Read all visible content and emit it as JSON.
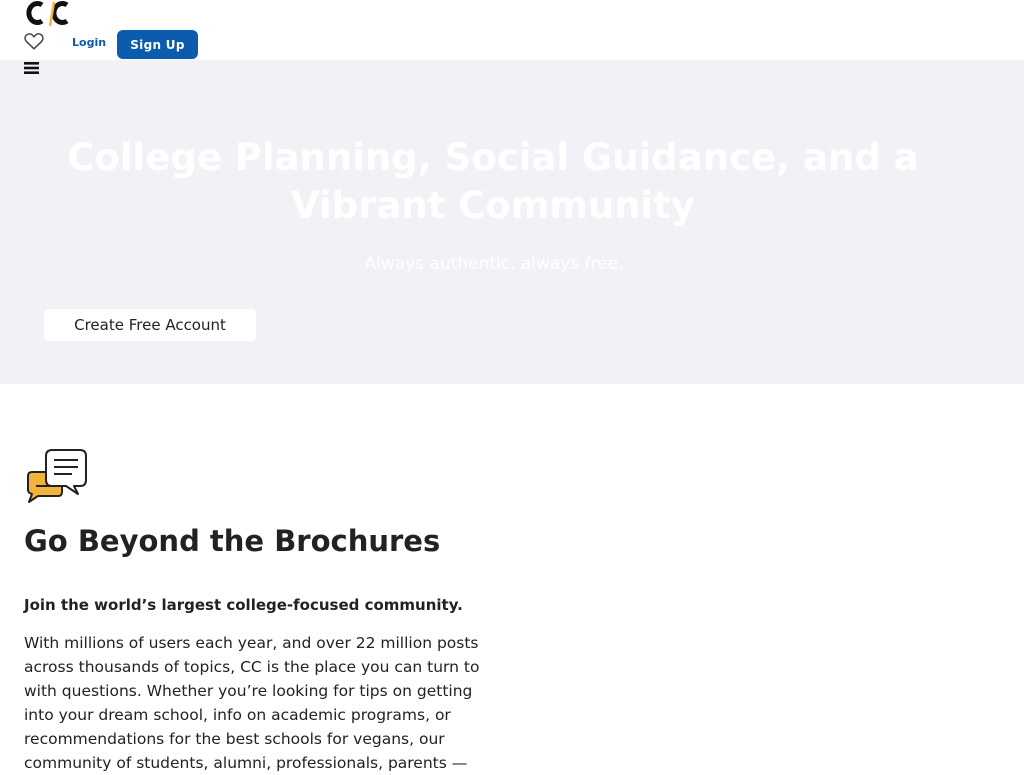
{
  "header": {
    "logo_icon": "cc-logo-icon",
    "favorites_icon": "heart-icon",
    "login_label": "Login",
    "signup_label": "Sign Up"
  },
  "hero": {
    "menu_icon": "hamburger-menu-icon",
    "title": "College Planning, Social Guidance, and a Vibrant Community",
    "subtitle": "Always authentic, always free.",
    "cta_label": "Create Free Account",
    "background_color": "#f0f2f6"
  },
  "feature": {
    "icon": "chat-bubbles-icon",
    "title": "Go Beyond the Brochures",
    "lead": "Join the world’s largest college-focused community.",
    "body": "With millions of users each year, and over 22 million posts across thousands of topics, CC is the place you can turn to with questions. Whether you’re looking for tips on getting into your dream school, info on academic programs, or recommendations for the best schools for vegans, our community of students, alumni, professionals, parents —"
  },
  "colors": {
    "accent": "#0b5cad",
    "logo_accent": "#f2b53a",
    "text": "#222222"
  }
}
